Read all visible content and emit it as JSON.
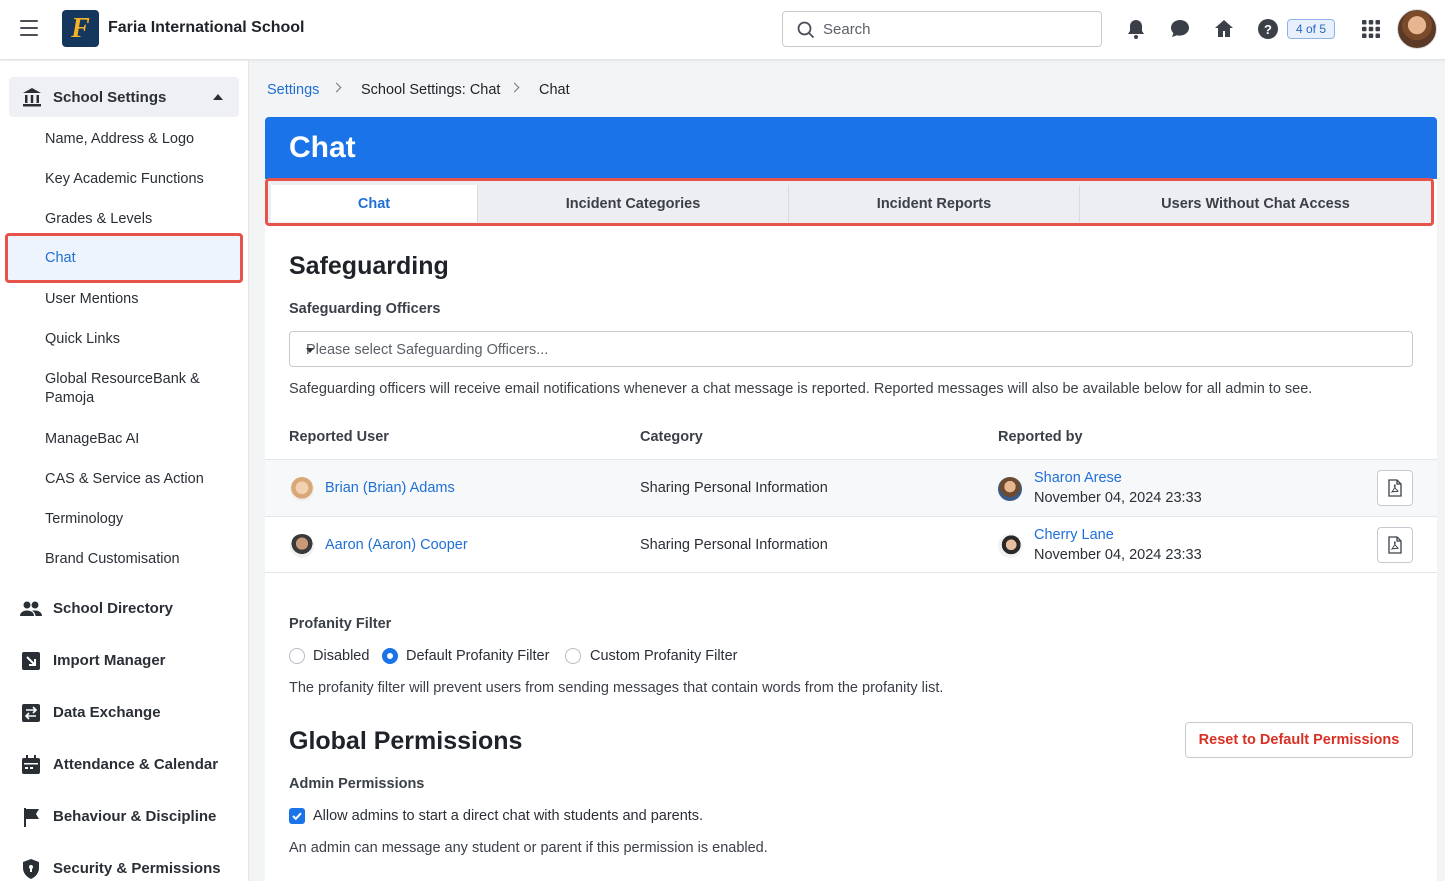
{
  "header": {
    "school_name": "Faria International School",
    "logo_letter": "F",
    "search_placeholder": "Search",
    "steps_badge": "4 of 5"
  },
  "sidebar": {
    "group_label": "School Settings",
    "sub_items": [
      "Name, Address & Logo",
      "Key Academic Functions",
      "Grades & Levels",
      "Chat",
      "User Mentions",
      "Quick Links",
      "Global ResourceBank &",
      "Pamoja",
      "ManageBac AI",
      "CAS & Service as Action",
      "Terminology",
      "Brand Customisation"
    ],
    "main_items": [
      "School Directory",
      "Import Manager",
      "Data Exchange",
      "Attendance & Calendar",
      "Behaviour & Discipline",
      "Security & Permissions"
    ]
  },
  "breadcrumb": [
    "Settings",
    "School Settings: Chat",
    "Chat"
  ],
  "page_title": "Chat",
  "tabs": [
    "Chat",
    "Incident Categories",
    "Incident Reports",
    "Users Without Chat Access"
  ],
  "safeguarding": {
    "title": "Safeguarding",
    "officers_label": "Safeguarding Officers",
    "officers_placeholder": "Please select Safeguarding Officers...",
    "description": "Safeguarding officers will receive email notifications whenever a chat message is reported. Reported messages will also be available below for all admin to see."
  },
  "table": {
    "headers": [
      "Reported User",
      "Category",
      "Reported by"
    ],
    "rows": [
      {
        "user": "Brian (Brian) Adams",
        "category": "Sharing Personal Information",
        "reporter": "Sharon Arese",
        "date": "November 04, 2024 23:33"
      },
      {
        "user": "Aaron (Aaron) Cooper",
        "category": "Sharing Personal Information",
        "reporter": "Cherry Lane",
        "date": "November 04, 2024 23:33"
      }
    ]
  },
  "profanity": {
    "label": "Profanity Filter",
    "options": [
      "Disabled",
      "Default Profanity Filter",
      "Custom Profanity Filter"
    ],
    "selected": "Default Profanity Filter",
    "description": "The profanity filter will prevent users from sending messages that contain words from the profanity list."
  },
  "permissions": {
    "title": "Global Permissions",
    "reset_label": "Reset to Default Permissions",
    "admin_label": "Admin Permissions",
    "admin_checkbox": "Allow admins to start a direct chat with students and parents.",
    "admin_note": "An admin can message any student or parent if this permission is enabled."
  },
  "colors": {
    "accent": "#1a73e8",
    "highlight": "#e5534b",
    "danger": "#d93025"
  }
}
